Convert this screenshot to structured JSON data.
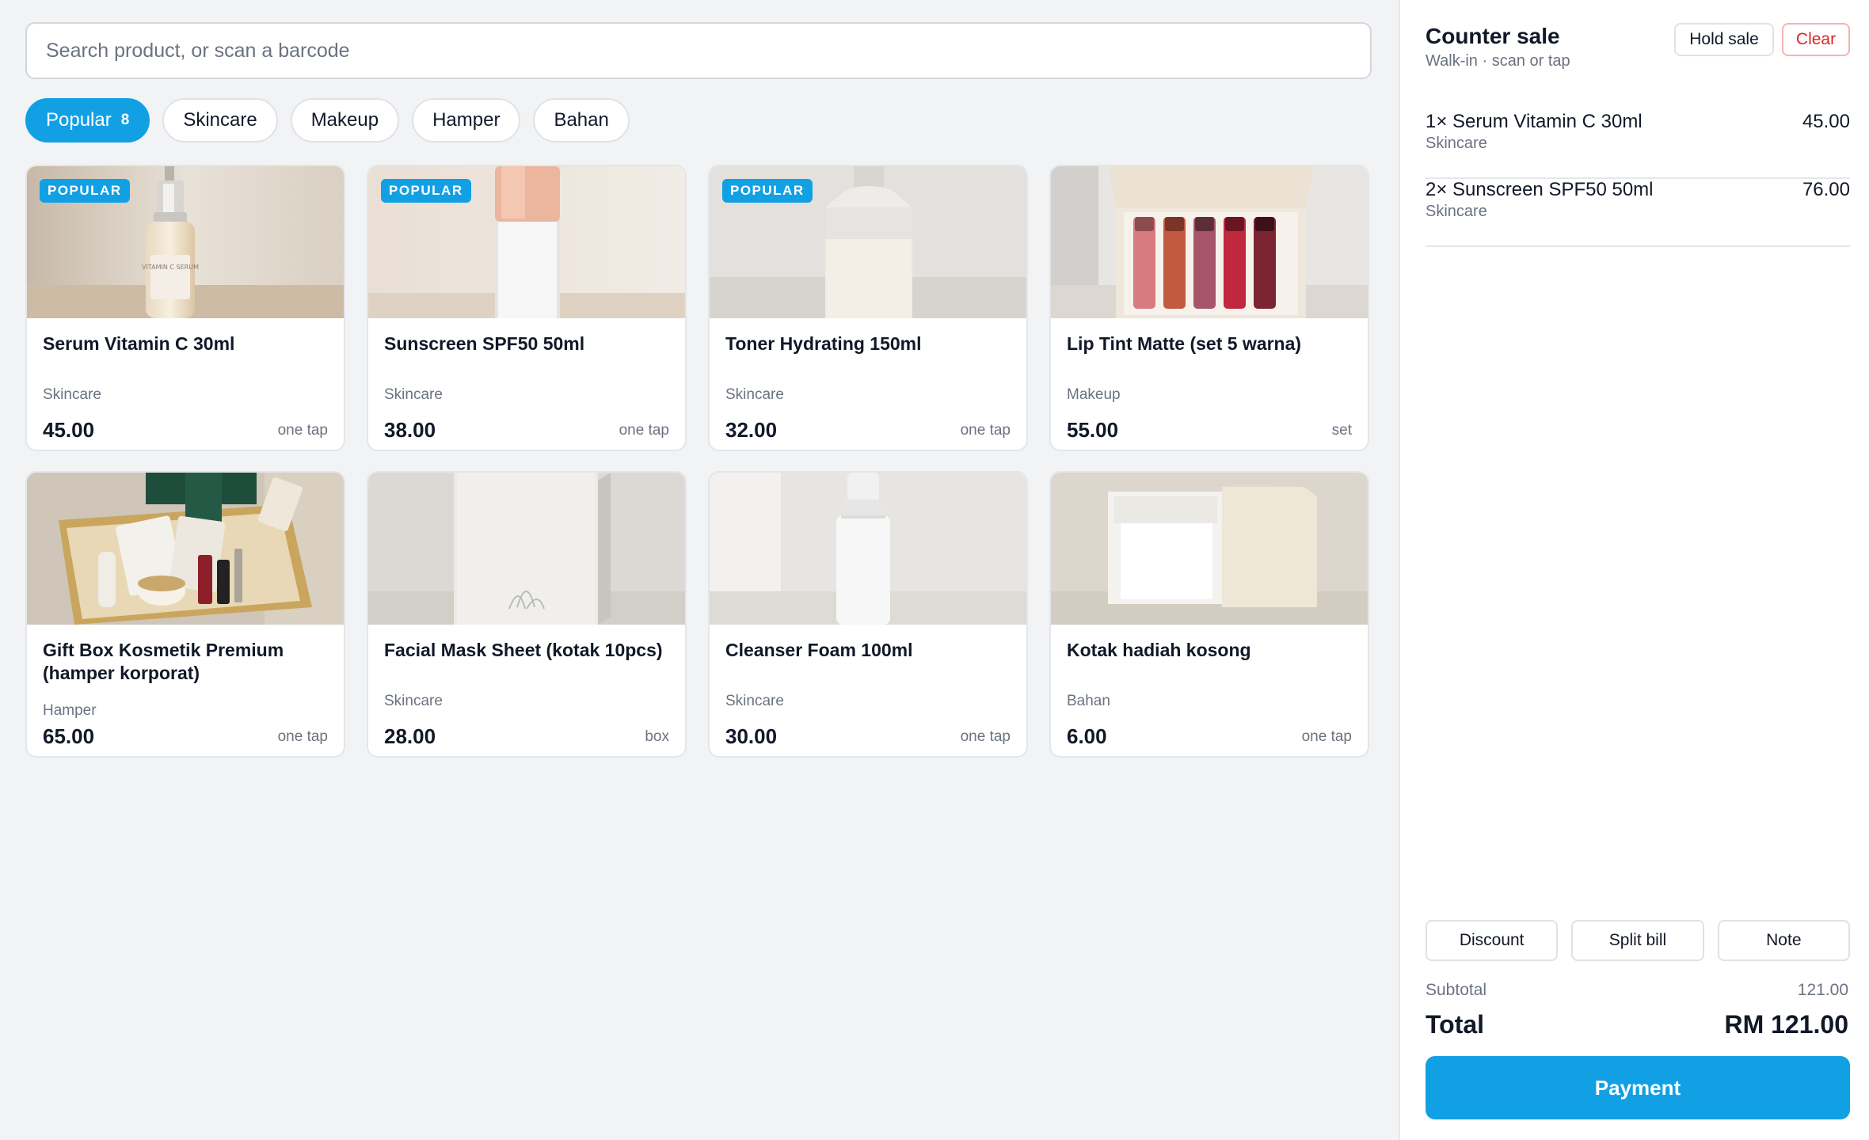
{
  "search": {
    "placeholder": "Search product, or scan a barcode"
  },
  "categories": [
    {
      "label": "Popular",
      "count": "8",
      "active": true
    },
    {
      "label": "Skincare"
    },
    {
      "label": "Makeup"
    },
    {
      "label": "Hamper"
    },
    {
      "label": "Bahan"
    }
  ],
  "products": [
    {
      "name": "Serum Vitamin C 30ml",
      "category": "Skincare",
      "price": "45.00",
      "hint": "one tap",
      "badge": "POPULAR",
      "image": "serum-bottle",
      "image_label": "VITAMIN C SERUM"
    },
    {
      "name": "Sunscreen SPF50 50ml",
      "category": "Skincare",
      "price": "38.00",
      "hint": "one tap",
      "badge": "POPULAR",
      "image": "sunscreen-tube"
    },
    {
      "name": "Toner Hydrating 150ml",
      "category": "Skincare",
      "price": "32.00",
      "hint": "one tap",
      "badge": "POPULAR",
      "image": "toner-bottle"
    },
    {
      "name": "Lip Tint Matte (set 5 warna)",
      "category": "Makeup",
      "price": "55.00",
      "hint": "set",
      "image": "lip-tint-set"
    },
    {
      "name": "Gift Box Kosmetik Premium (hamper korporat)",
      "category": "Hamper",
      "price": "65.00",
      "hint": "one tap",
      "image": "gift-hamper"
    },
    {
      "name": "Facial Mask Sheet (kotak 10pcs)",
      "category": "Skincare",
      "price": "28.00",
      "hint": "box",
      "image": "mask-box"
    },
    {
      "name": "Cleanser Foam 100ml",
      "category": "Skincare",
      "price": "30.00",
      "hint": "one tap",
      "image": "foam-pump"
    },
    {
      "name": "Kotak hadiah kosong",
      "category": "Bahan",
      "price": "6.00",
      "hint": "one tap",
      "image": "empty-box"
    }
  ],
  "sale": {
    "title": "Counter sale",
    "subtitle": "Walk-in · scan or tap",
    "hold_label": "Hold sale",
    "clear_label": "Clear",
    "lines": [
      {
        "name": "1× Serum Vitamin C 30ml",
        "category": "Skincare",
        "amount": "45.00"
      },
      {
        "name": "2× Sunscreen SPF50 50ml",
        "category": "Skincare",
        "amount": "76.00"
      }
    ],
    "actions": {
      "discount": "Discount",
      "split": "Split bill",
      "note": "Note"
    },
    "subtotal_label": "Subtotal",
    "subtotal": "121.00",
    "total_label": "Total",
    "total": "RM 121.00",
    "pay_label": "Payment"
  },
  "colors": {
    "accent": "#12a0e4",
    "danger": "#dc2626",
    "muted": "#6b7280",
    "background": "#f2f3f5"
  }
}
